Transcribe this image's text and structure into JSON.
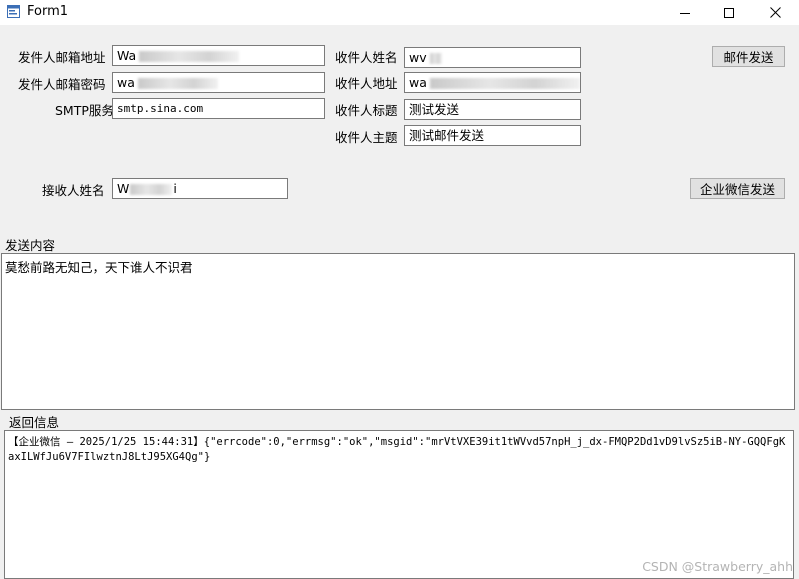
{
  "window": {
    "title": "Form1",
    "minimize_glyph": "—",
    "maximize_glyph": "☐",
    "close_glyph": "✕",
    "icon": "form-app-icon"
  },
  "sender": {
    "email_label": "发件人邮箱地址",
    "email_value": "Wa",
    "password_label": "发件人邮箱密码",
    "password_value": "wa",
    "smtp_label": "SMTP服务",
    "smtp_value": "smtp.sina.com"
  },
  "recipient": {
    "name_label": "收件人姓名",
    "name_value": "wv",
    "address_label": "收件人地址",
    "address_value": "wa",
    "title_label": "收件人标题",
    "title_value": "测试发送",
    "subject_label": "收件人主题",
    "subject_value": "测试邮件发送"
  },
  "wechat": {
    "receiver_label": "接收人姓名",
    "receiver_prefix": "W",
    "receiver_suffix": "i"
  },
  "buttons": {
    "send_email": "邮件发送",
    "send_wechat": "企业微信发送"
  },
  "content": {
    "label": "发送内容",
    "text": "莫愁前路无知己，天下谁人不识君"
  },
  "result": {
    "label": "返回信息",
    "text": "【企业微信 — 2025/1/25 15:44:31】{\"errcode\":0,\"errmsg\":\"ok\",\"msgid\":\"mrVtVXE39it1tWVvd57npH_j_dx-FMQP2Dd1vD9lvSz5iB-NY-GQQFgKaxILWfJu6V7FIlwztnJ8LtJ95XG4Qg\"}"
  },
  "watermark": "CSDN @Strawberry_ahh"
}
